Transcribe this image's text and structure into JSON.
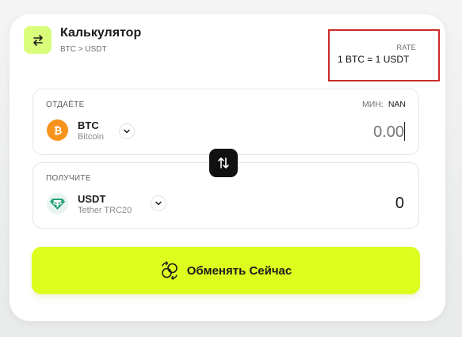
{
  "header": {
    "title": "Калькулятор",
    "pair": "BTC > USDT",
    "icon": "swap-arrows-icon"
  },
  "rate": {
    "label": "RATE",
    "value": "1 BTC = 1 USDT"
  },
  "give": {
    "label": "ОТДАЁТЕ",
    "min_label": "МИН:",
    "min_value": "NAN",
    "coin_symbol": "BTC",
    "coin_name": "Bitcoin",
    "coin_icon": "bitcoin-icon",
    "amount_placeholder": "0.00"
  },
  "get": {
    "label": "ПОЛУЧИТЕ",
    "coin_symbol": "USDT",
    "coin_name": "Tether TRC20",
    "coin_icon": "tether-icon",
    "amount": "0"
  },
  "exchange_button": {
    "label": "Обменять Сейчас",
    "icon": "exchange-icon"
  },
  "colors": {
    "accent": "#dcfd1e",
    "logo_bg": "#d9fc7b",
    "bitcoin": "#f7931a",
    "tether": "#26a17b",
    "highlight_border": "#cc2a2a"
  }
}
